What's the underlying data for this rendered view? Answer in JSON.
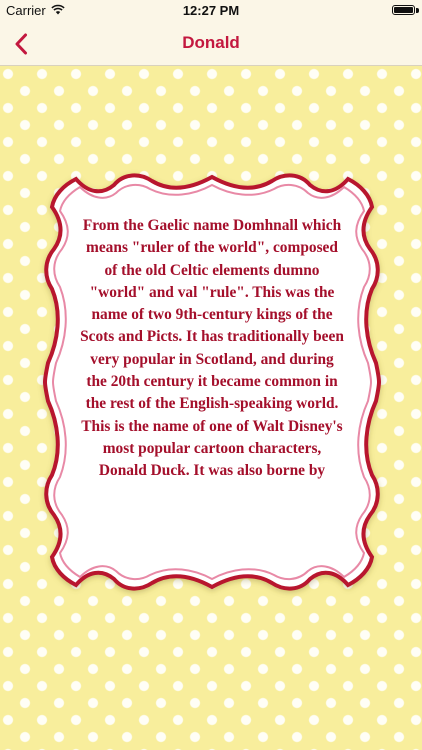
{
  "status_bar": {
    "carrier": "Carrier",
    "time": "12:27 PM",
    "wifi_icon": "wifi-icon",
    "battery_icon": "battery-icon"
  },
  "nav": {
    "title": "Donald",
    "back_icon": "chevron-left-icon"
  },
  "card": {
    "text": "From the Gaelic name Domhnall which means \"ruler of the world\", composed of the old Celtic elements dumno \"world\" and val \"rule\". This was the name of two 9th-century kings of the Scots and Picts. It has traditionally been very popular in Scotland, and during the 20th century it became common in the rest of the English-speaking world. This is the name of one of Walt Disney's most popular cartoon characters, Donald Duck. It was also borne by"
  },
  "colors": {
    "accent": "#c3183f",
    "text": "#a40f2b",
    "background": "#f8ee9c",
    "polka_dot": "#fffef6",
    "bar_background": "#fbf6e7"
  }
}
